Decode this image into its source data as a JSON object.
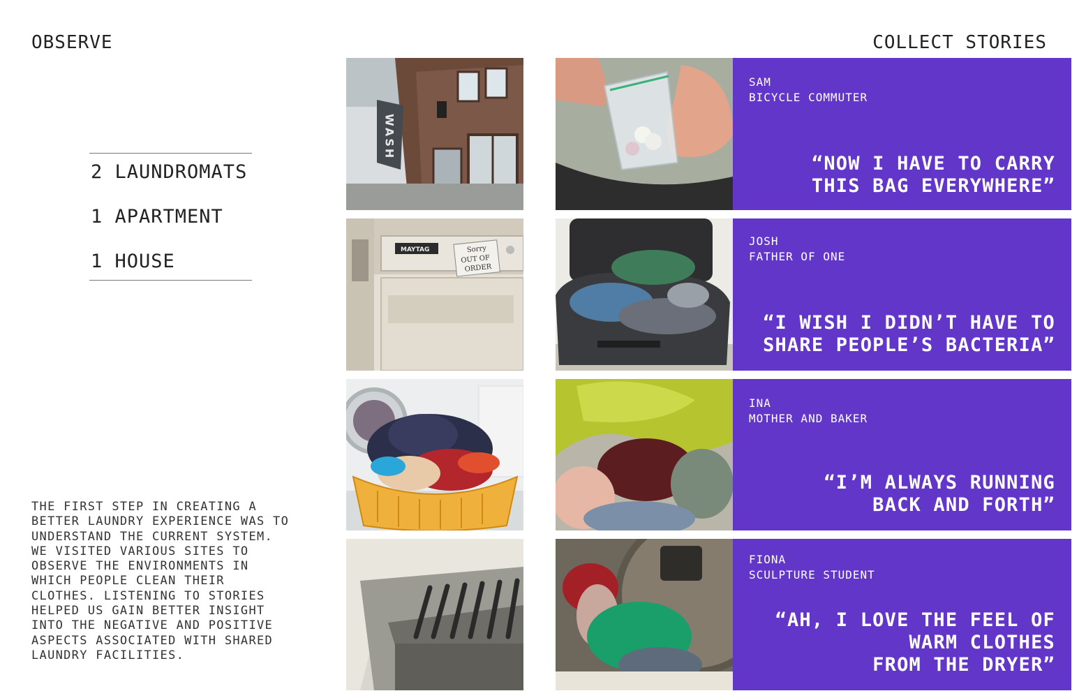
{
  "header": {
    "left": "OBSERVE",
    "right": "COLLECT STORIES"
  },
  "stats": [
    "2 LAUNDROMATS",
    "1 APARTMENT",
    "1 HOUSE"
  ],
  "paragraph_lines": [
    "THE FIRST STEP IN CREATING A",
    "BETTER LAUNDRY EXPERIENCE WAS TO",
    "UNDERSTAND THE CURRENT SYSTEM.",
    "WE VISITED VARIOUS SITES TO",
    "OBSERVE THE ENVIRONMENTS IN",
    "WHICH PEOPLE CLEAN THEIR",
    "CLOTHES. LISTENING TO STORIES",
    "HELPED US GAIN BETTER INSIGHT",
    "INTO THE NEGATIVE AND POSITIVE",
    "ASPECTS ASSOCIATED WITH SHARED",
    "LAUNDRY FACILITIES."
  ],
  "photo_text": {
    "wash_sign": "WASH",
    "out_of_order_sign": [
      "Sorry",
      "OUT OF",
      "ORDER"
    ],
    "maytag_label": "MAYTAG"
  },
  "stories": [
    {
      "name": "SAM",
      "role": "BICYCLE COMMUTER",
      "quote_lines": [
        "“NOW I HAVE TO CARRY",
        "THIS BAG EVERYWHERE”"
      ]
    },
    {
      "name": "JOSH",
      "role": "FATHER OF ONE",
      "quote_lines": [
        "“I WISH I DIDN’T HAVE TO",
        "SHARE PEOPLE’S BACTERIA”"
      ]
    },
    {
      "name": "INA",
      "role": "MOTHER AND BAKER",
      "quote_lines": [
        "“I’M ALWAYS RUNNING",
        "BACK AND FORTH”"
      ]
    },
    {
      "name": "FIONA",
      "role": "SCULPTURE STUDENT",
      "quote_lines": [
        "“AH, I LOVE THE FEEL OF",
        "WARM CLOTHES",
        "FROM THE DRYER”"
      ]
    }
  ],
  "colors": {
    "story_panel": "#6236c8",
    "text": "#222222"
  }
}
